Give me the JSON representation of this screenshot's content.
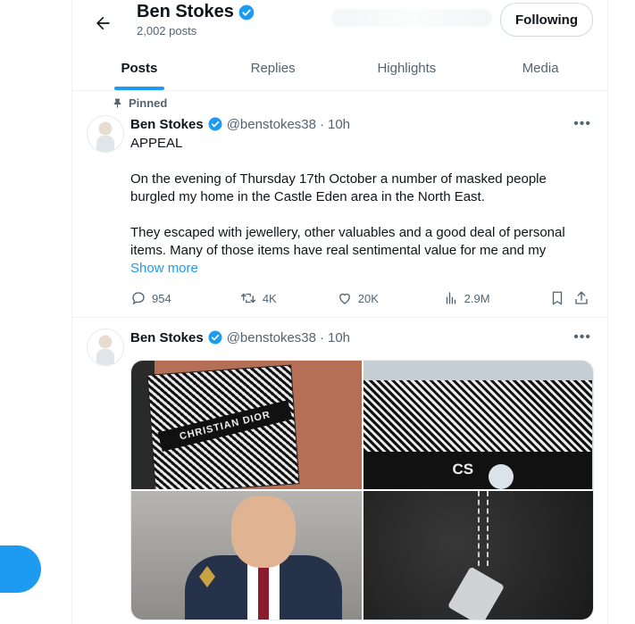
{
  "header": {
    "name": "Ben Stokes",
    "posts_count": "2,002 posts",
    "follow_label": "Following"
  },
  "tabs": [
    "Posts",
    "Replies",
    "Highlights",
    "Media"
  ],
  "tweets": [
    {
      "pinned_label": "Pinned",
      "name": "Ben Stokes",
      "handle": "@benstokes38",
      "separator": "·",
      "time": "10h",
      "paragraphs": [
        "APPEAL",
        "On the evening of Thursday 17th October a number of masked people burgled my home in the Castle Eden area in the North East.",
        "They escaped with jewellery, other valuables and a good deal of personal items. Many of those items have real sentimental value for me and my"
      ],
      "show_more": "Show more",
      "replies": "954",
      "reposts": "4K",
      "likes": "20K",
      "views": "2.9M"
    },
    {
      "name": "Ben Stokes",
      "handle": "@benstokes38",
      "separator": "·",
      "time": "10h",
      "photos": [
        {
          "icon": "bag-photo",
          "text": "CHRISTIAN DIOR"
        },
        {
          "icon": "bag-photo",
          "text": "CS"
        },
        {
          "icon": "person-photo"
        },
        {
          "icon": "necklace-photo"
        }
      ]
    }
  ],
  "colors": {
    "accent": "#1d9bf0",
    "text": "#0f1419",
    "muted": "#536471",
    "border": "#eff3f4"
  }
}
